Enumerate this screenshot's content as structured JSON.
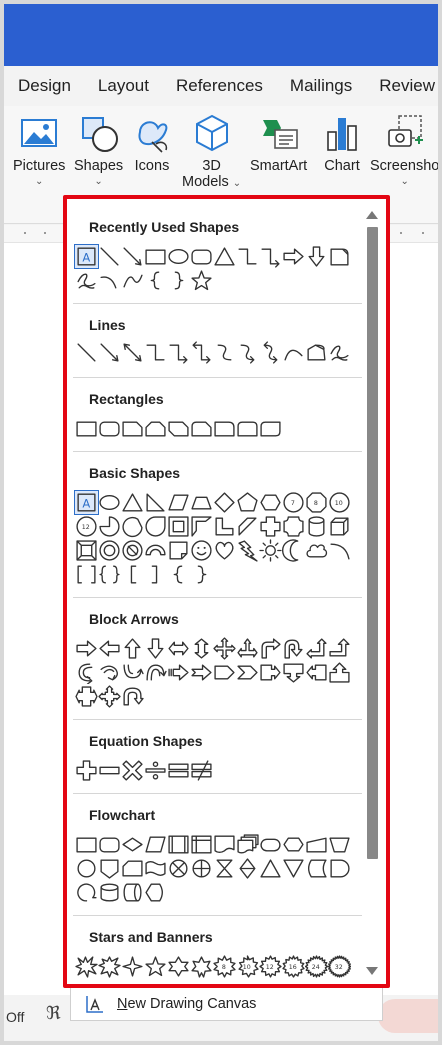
{
  "ribbon_tabs": [
    "Design",
    "Layout",
    "References",
    "Mailings",
    "Review"
  ],
  "ribbon_buttons": {
    "pictures": "Pictures",
    "shapes": "Shapes",
    "icons": "Icons",
    "models_line1": "3D",
    "models_line2": "Models",
    "smartart": "SmartArt",
    "chart": "Chart",
    "screenshot": "Screensho"
  },
  "dropdown": {
    "sections": [
      {
        "title": "Recently Used Shapes"
      },
      {
        "title": "Lines"
      },
      {
        "title": "Rectangles"
      },
      {
        "title": "Basic Shapes"
      },
      {
        "title": "Block Arrows"
      },
      {
        "title": "Equation Shapes"
      },
      {
        "title": "Flowchart"
      },
      {
        "title": "Stars and Banners"
      }
    ],
    "new_drawing_canvas_prefix": "N",
    "new_drawing_canvas_rest": "ew Drawing Canvas"
  },
  "status": {
    "off_label": "Off"
  },
  "colors": {
    "title_bar": "#2b5fd0",
    "highlight_border": "#e30613",
    "selected_shape": "#2d6ec8"
  },
  "icons": {
    "pictures": "picture-icon",
    "shapes": "shapes-icon",
    "icons": "bird-leaf-icon",
    "models": "cube-icon",
    "smartart": "smartart-icon",
    "chart": "bar-chart-icon",
    "screenshot": "screenshot-icon"
  }
}
